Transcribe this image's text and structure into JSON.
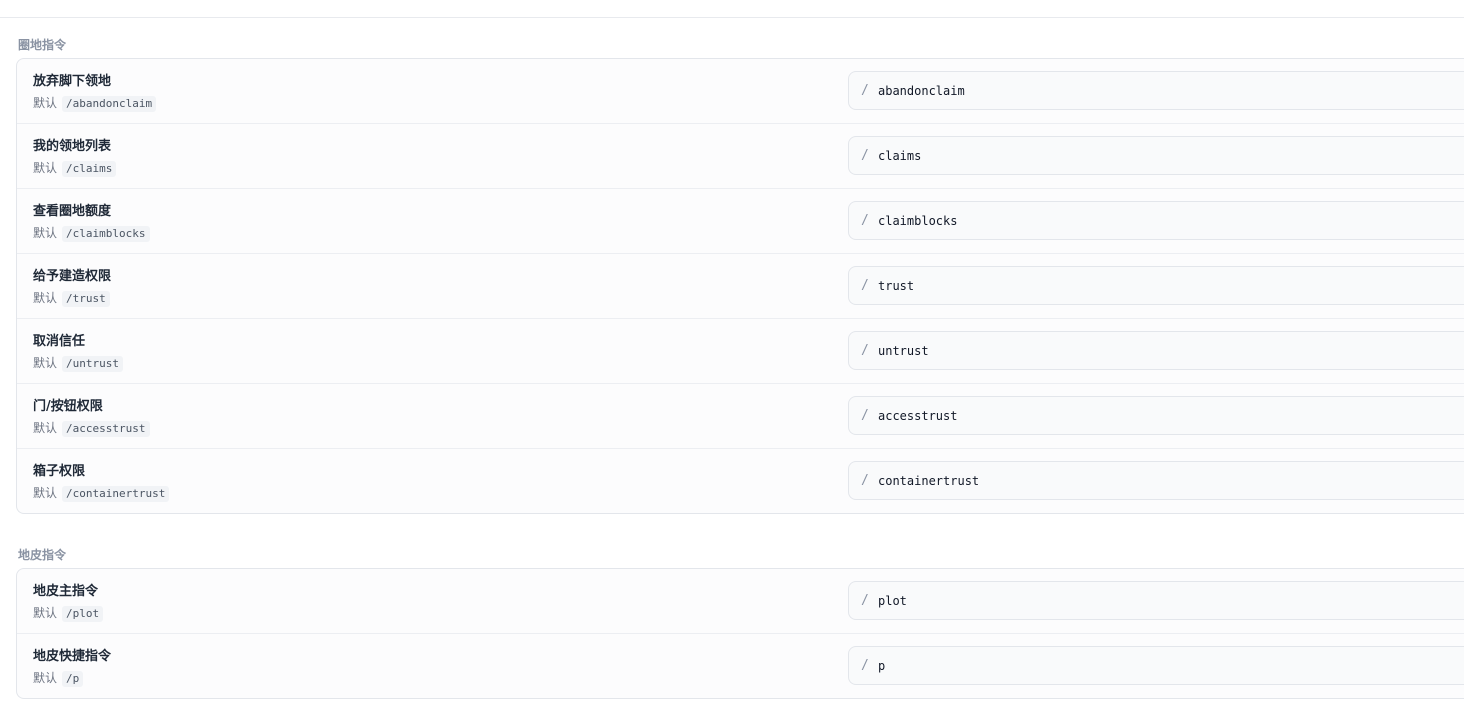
{
  "sections": [
    {
      "label": "圈地指令",
      "rows": [
        {
          "title": "放弃脚下领地",
          "default_label": "默认",
          "default_cmd": "/abandonclaim",
          "value": "abandonclaim"
        },
        {
          "title": "我的领地列表",
          "default_label": "默认",
          "default_cmd": "/claims",
          "value": "claims"
        },
        {
          "title": "查看圈地额度",
          "default_label": "默认",
          "default_cmd": "/claimblocks",
          "value": "claimblocks"
        },
        {
          "title": "给予建造权限",
          "default_label": "默认",
          "default_cmd": "/trust",
          "value": "trust"
        },
        {
          "title": "取消信任",
          "default_label": "默认",
          "default_cmd": "/untrust",
          "value": "untrust"
        },
        {
          "title": "门/按钮权限",
          "default_label": "默认",
          "default_cmd": "/accesstrust",
          "value": "accesstrust"
        },
        {
          "title": "箱子权限",
          "default_label": "默认",
          "default_cmd": "/containertrust",
          "value": "containertrust"
        }
      ]
    },
    {
      "label": "地皮指令",
      "rows": [
        {
          "title": "地皮主指令",
          "default_label": "默认",
          "default_cmd": "/plot",
          "value": "plot"
        },
        {
          "title": "地皮快捷指令",
          "default_label": "默认",
          "default_cmd": "/p",
          "value": "p"
        }
      ]
    }
  ],
  "slash": "/"
}
